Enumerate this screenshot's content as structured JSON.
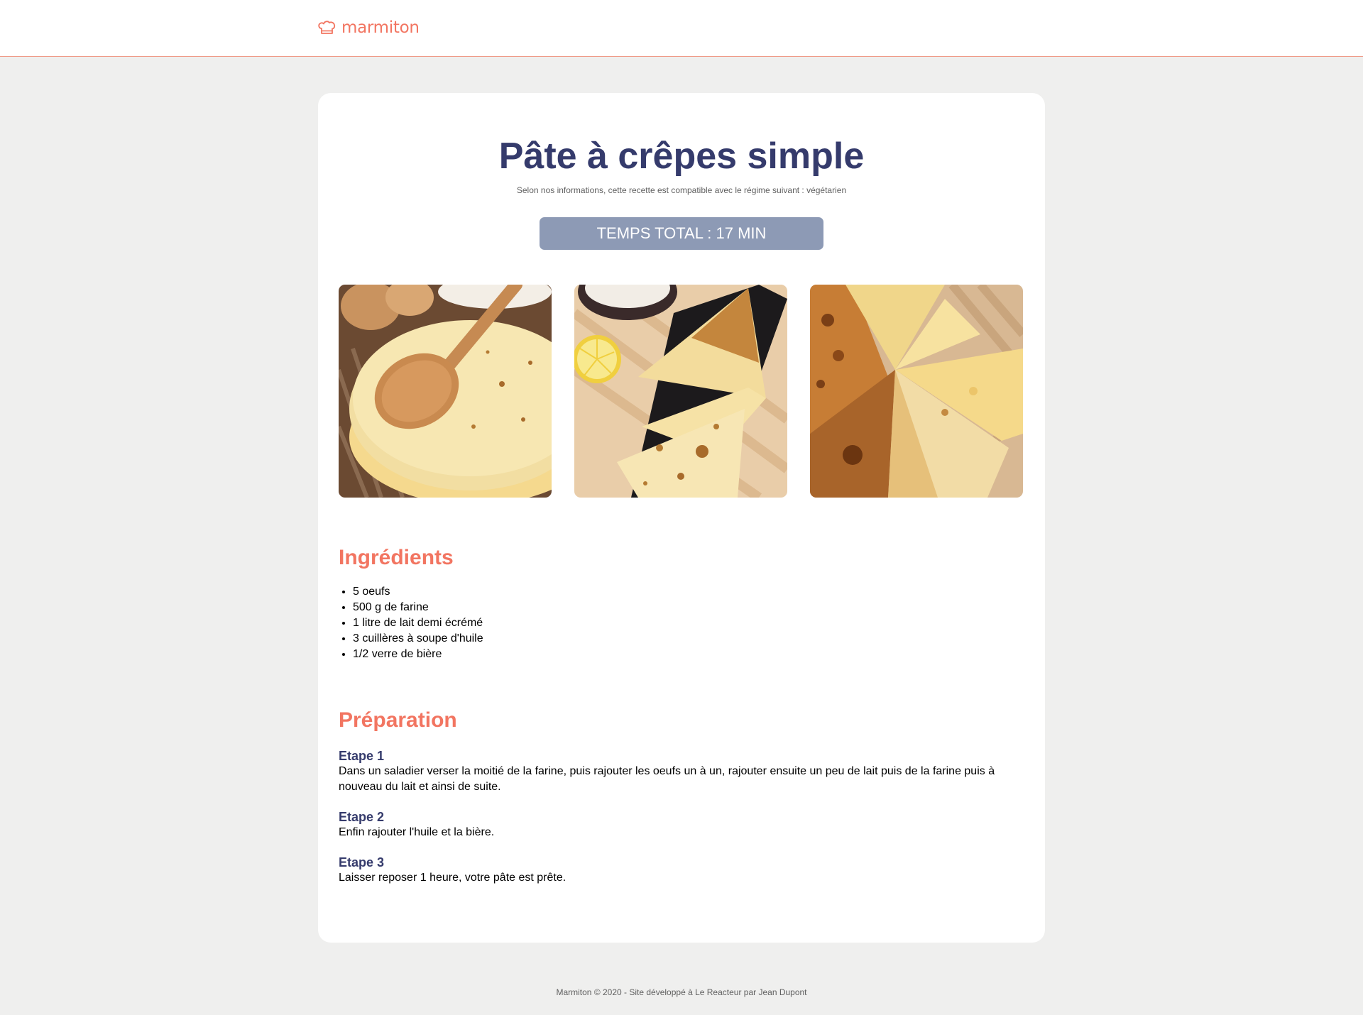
{
  "header": {
    "logo_text": "marmiton"
  },
  "recipe": {
    "title": "Pâte à crêpes simple",
    "diet_note": "Selon nos informations, cette recette est compatible avec le régime suivant : végétarien",
    "total_time": "TEMPS TOTAL : 17 MIN"
  },
  "ingredients": {
    "title": "Ingrédients",
    "items": [
      "5 oeufs",
      "500 g de farine",
      "1 litre de lait demi écrémé",
      "3 cuillères à soupe d'huile",
      "1/2 verre de bière"
    ]
  },
  "preparation": {
    "title": "Préparation",
    "steps": [
      {
        "title": "Etape 1",
        "text": "Dans un saladier verser la moitié de la farine, puis rajouter les oeufs un à un, rajouter ensuite un peu de lait puis de la farine puis à nouveau du lait et ainsi de suite."
      },
      {
        "title": "Etape 2",
        "text": "Enfin rajouter l'huile et la bière."
      },
      {
        "title": "Etape 3",
        "text": "Laisser reposer 1 heure, votre pâte est prête."
      }
    ]
  },
  "footer": {
    "text": "Marmiton © 2020 - Site développé à Le Reacteur par Jean Dupont"
  },
  "colors": {
    "brand": "#f27561",
    "title": "#353b6c",
    "time_badge": "#8d9ab5",
    "background": "#efefee"
  }
}
